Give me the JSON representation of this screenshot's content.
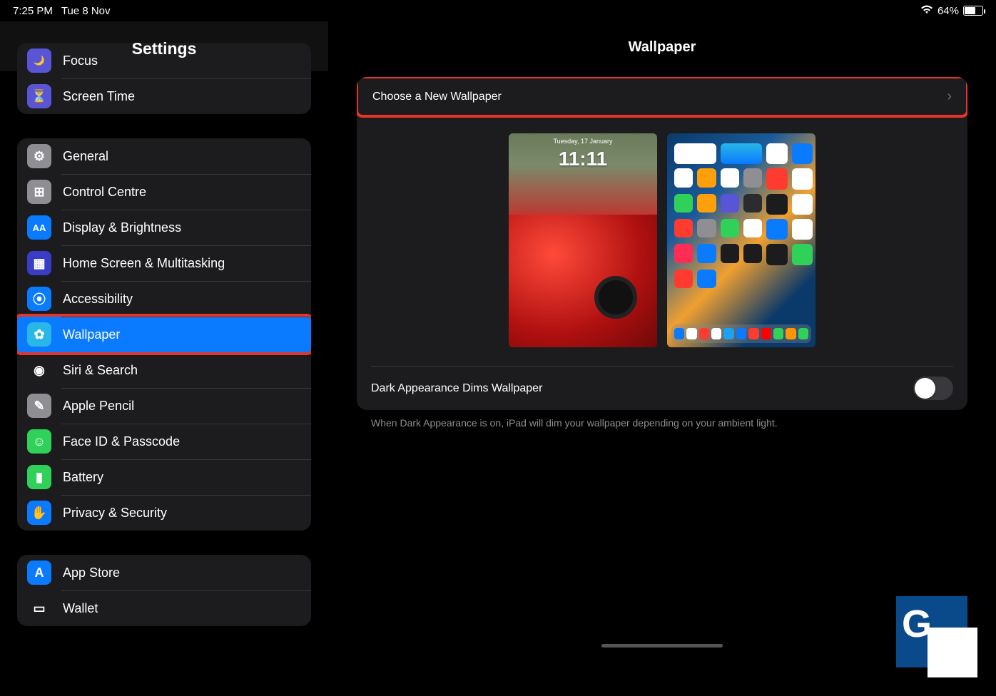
{
  "status": {
    "time": "7:25 PM",
    "date": "Tue 8 Nov",
    "battery_pct": "64%",
    "battery_fill": 64
  },
  "sidebar": {
    "title": "Settings",
    "groups": [
      {
        "items": [
          {
            "label": "Focus",
            "icon_bg": "#5856d6",
            "glyph": "🌙"
          },
          {
            "label": "Screen Time",
            "icon_bg": "#5856d6",
            "glyph": "⏳"
          }
        ]
      },
      {
        "items": [
          {
            "label": "General",
            "icon_bg": "#8e8e93",
            "glyph": "⚙"
          },
          {
            "label": "Control Centre",
            "icon_bg": "#8e8e93",
            "glyph": "⊞"
          },
          {
            "label": "Display & Brightness",
            "icon_bg": "#0a7aff",
            "glyph": "AA"
          },
          {
            "label": "Home Screen & Multitasking",
            "icon_bg": "#3a3cc8",
            "glyph": "▦"
          },
          {
            "label": "Accessibility",
            "icon_bg": "#0a7aff",
            "glyph": "⦿"
          },
          {
            "label": "Wallpaper",
            "icon_bg": "#28b7e6",
            "glyph": "✿",
            "selected": true,
            "highlight": true
          },
          {
            "label": "Siri & Search",
            "icon_bg": "#1c1c1e",
            "glyph": "◉"
          },
          {
            "label": "Apple Pencil",
            "icon_bg": "#8e8e93",
            "glyph": "✎"
          },
          {
            "label": "Face ID & Passcode",
            "icon_bg": "#30d158",
            "glyph": "☺"
          },
          {
            "label": "Battery",
            "icon_bg": "#30d158",
            "glyph": "▮"
          },
          {
            "label": "Privacy & Security",
            "icon_bg": "#0a7aff",
            "glyph": "✋"
          }
        ]
      },
      {
        "items": [
          {
            "label": "App Store",
            "icon_bg": "#0a7aff",
            "glyph": "A"
          },
          {
            "label": "Wallet",
            "icon_bg": "#1c1c1e",
            "glyph": "▭"
          }
        ]
      }
    ]
  },
  "detail": {
    "title": "Wallpaper",
    "choose_label": "Choose a New Wallpaper",
    "lock_time": "11:11",
    "lock_date": "Tuesday, 17 January",
    "toggle_label": "Dark Appearance Dims Wallpaper",
    "toggle_on": false,
    "footer": "When Dark Appearance is on, iPad will dim your wallpaper depending on your ambient light."
  },
  "home_apps": [
    "#ffffff",
    "#30d158",
    "#ffffff",
    "#0a7aff",
    "#ffffff",
    "#ff9f0a",
    "#ffffff",
    "#8e8e93",
    "#ff3b30",
    "#ffffff",
    "#30d158",
    "#ff9f0a",
    "#5856d6",
    "#2c2c2e",
    "#1c1c1e",
    "#ffffff",
    "#ff3b30",
    "#8e8e93",
    "#30d158",
    "#ffffff",
    "#0a7aff",
    "#ffffff",
    "#ff2d55",
    "#0a7aff",
    "#1c1c1e",
    "#1c1c1e",
    "#1c1c1e",
    "#30d158",
    "#ff3b30",
    "#0a7aff",
    "#ff3b30",
    "#0a7aff",
    "#0a7aff",
    "#0a7aff",
    "#ffffff",
    "#ffffff"
  ],
  "dock_apps": [
    "#0a7aff",
    "#ffffff",
    "#ff3b30",
    "#ffffff",
    "#1da1f2",
    "#0a7aff",
    "#ff3b30",
    "#ff0000",
    "#30d158",
    "#ff9500",
    "#30d158"
  ]
}
